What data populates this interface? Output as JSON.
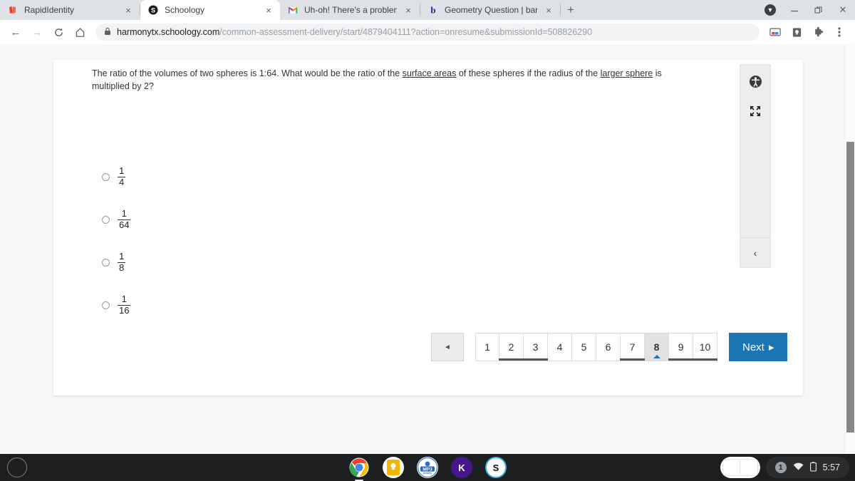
{
  "browser": {
    "tabs": [
      {
        "title": "RapidIdentity",
        "favicon": "rapididentity-icon",
        "active": false
      },
      {
        "title": "Schoology",
        "favicon": "schoology-icon",
        "active": true
      },
      {
        "title": "Uh-oh! There's a problem with yo",
        "favicon": "gmail-icon",
        "active": false
      },
      {
        "title": "Geometry Question | bartleby",
        "favicon": "bartleby-icon",
        "active": false
      }
    ],
    "new_tab_label": "+",
    "close_label": "×",
    "window_controls": {
      "download": "download-icon",
      "minimize": "—",
      "restore": "❐",
      "close": "✕"
    },
    "nav": {
      "back": "←",
      "forward": "→",
      "reload": "↻",
      "home": "⌂"
    },
    "omnibox": {
      "lock": "🔒",
      "host": "harmonytx.schoology.com",
      "path": "/common-assessment-delivery/start/4879404111?action=onresume&submissionId=508826290"
    },
    "toolbar_right": [
      "media-cast-icon",
      "save-to-keep-icon",
      "extensions-puzzle-icon",
      "chrome-menu-icon"
    ]
  },
  "assessment": {
    "question": {
      "part1": "The ratio of the volumes of two spheres is 1:64. What would be the ratio of the ",
      "link1": "surface areas",
      "part2": " of these spheres if the radius of the ",
      "link2": "larger sphere",
      "part3": " is multiplied by 2?"
    },
    "choices": [
      {
        "numerator": "1",
        "denominator": "4",
        "selected": false
      },
      {
        "numerator": "1",
        "denominator": "64",
        "selected": false
      },
      {
        "numerator": "1",
        "denominator": "8",
        "selected": false
      },
      {
        "numerator": "1",
        "denominator": "16",
        "selected": false
      }
    ],
    "pager": {
      "prev_label": "◄",
      "pages": [
        {
          "label": "1",
          "state": "unanswered"
        },
        {
          "label": "2",
          "state": "answered"
        },
        {
          "label": "3",
          "state": "answered"
        },
        {
          "label": "4",
          "state": "unanswered"
        },
        {
          "label": "5",
          "state": "unanswered"
        },
        {
          "label": "6",
          "state": "unanswered"
        },
        {
          "label": "7",
          "state": "answered"
        },
        {
          "label": "8",
          "state": "active"
        },
        {
          "label": "9",
          "state": "answered"
        },
        {
          "label": "10",
          "state": "answered"
        }
      ],
      "next_label": "Next",
      "next_arrow": "▸",
      "accent_color": "#1b74b4"
    },
    "rail": {
      "accessibility_icon": "accessibility-icon",
      "fullscreen_icon": "fullscreen-expand-icon",
      "collapse_icon": "‹"
    }
  },
  "shelf": {
    "launcher": "launcher-circle-icon",
    "apps": [
      {
        "name": "chrome-icon",
        "label": "",
        "active": true
      },
      {
        "name": "google-keep-icon",
        "label": "",
        "active": false
      },
      {
        "name": "mp3-delivery-icon",
        "label": "MP3",
        "active": false
      },
      {
        "name": "kahoot-icon",
        "label": "K",
        "active": false
      },
      {
        "name": "schoology-icon",
        "label": "S",
        "active": false
      }
    ],
    "tray": {
      "notification_count": "1",
      "wifi": "wifi-icon",
      "battery": "battery-icon",
      "time": "5:57"
    }
  }
}
